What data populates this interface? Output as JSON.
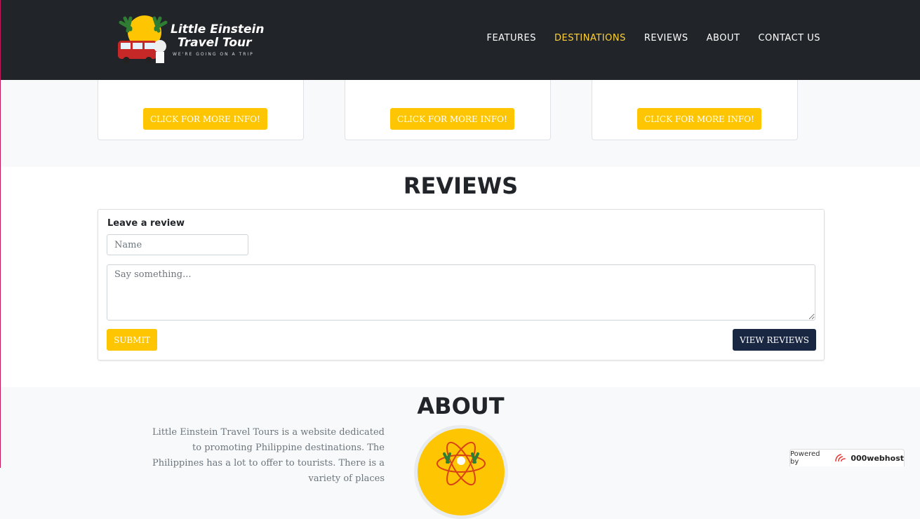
{
  "brand": {
    "title_line1": "Little Einstein",
    "title_line2": "Travel Tour",
    "tagline": "WE'RE GOING ON A TRIP"
  },
  "nav": [
    {
      "label": "FEATURES",
      "active": false
    },
    {
      "label": "DESTINATIONS",
      "active": true
    },
    {
      "label": "REVIEWS",
      "active": false
    },
    {
      "label": "ABOUT",
      "active": false
    },
    {
      "label": "CONTACT US",
      "active": false
    }
  ],
  "destinations": {
    "cards": [
      {
        "button_label": "CLICK FOR MORE INFO!"
      },
      {
        "button_label": "CLICK FOR MORE INFO!"
      },
      {
        "button_label": "CLICK FOR MORE INFO!"
      }
    ]
  },
  "reviews": {
    "title": "REVIEWS",
    "form_heading": "Leave a review",
    "name_placeholder": "Name",
    "message_placeholder": "Say something...",
    "submit_label": "SUBMIT",
    "view_label": "VIEW REVIEWS"
  },
  "about": {
    "title": "ABOUT",
    "text": "Little Einstein Travel Tours is a website dedicated to promoting Philippine destinations. The Philippines has a lot to offer to tourists. There is a variety of places"
  },
  "powered": {
    "prefix": "Powered by",
    "brand": "000webhost"
  },
  "colors": {
    "navbar": "#212529",
    "accent": "#fec503",
    "active_link": "#fed136",
    "view_button": "#1a2742"
  }
}
